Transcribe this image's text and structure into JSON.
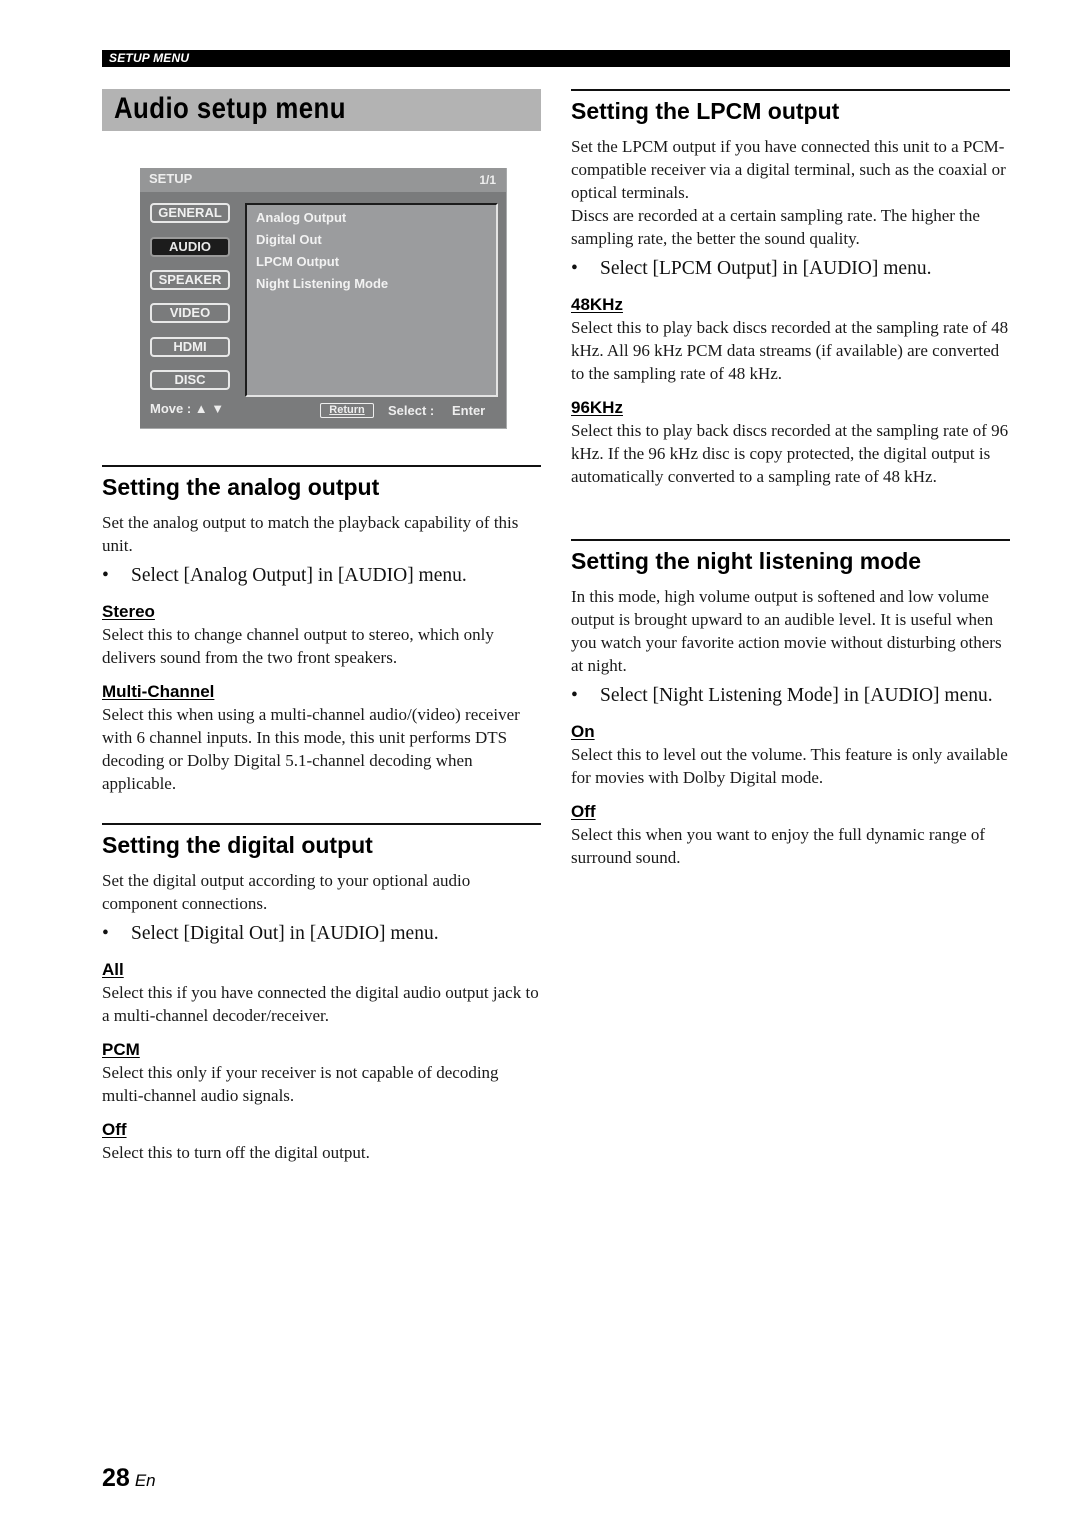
{
  "header": {
    "section_label": "SETUP MENU"
  },
  "page_title": "Audio setup menu",
  "osd_menu": {
    "title": "SETUP",
    "page_indicator": "1/1",
    "categories": [
      {
        "label": "GENERAL",
        "active": false
      },
      {
        "label": "AUDIO",
        "active": true
      },
      {
        "label": "SPEAKER",
        "active": false
      },
      {
        "label": "VIDEO",
        "active": false
      },
      {
        "label": "HDMI",
        "active": false
      },
      {
        "label": "DISC",
        "active": false
      }
    ],
    "items": [
      "Analog Output",
      "Digital Out",
      "LPCM Output",
      "Night Listening Mode"
    ],
    "footer": {
      "move_label": "Move : ▲ ▼",
      "return_label": "Return",
      "select_label": "Select :",
      "enter_label": "Enter"
    }
  },
  "sections": {
    "analog": {
      "heading": "Setting the analog output",
      "intro": "Set the analog output to match the playback capability of this unit.",
      "bullet": "Select [Analog Output] in [AUDIO] menu.",
      "options": [
        {
          "name": "Stereo",
          "desc": "Select this to change channel output to stereo, which only delivers sound from the two front speakers."
        },
        {
          "name": "Multi-Channel",
          "desc": "Select this when using a multi-channel audio/(video) receiver with 6 channel inputs. In this mode, this unit performs DTS decoding or Dolby Digital 5.1-channel decoding when applicable."
        }
      ]
    },
    "digital": {
      "heading": "Setting the digital output",
      "intro": "Set the digital output according to your optional audio component connections.",
      "bullet": "Select [Digital Out] in [AUDIO] menu.",
      "options": [
        {
          "name": "All",
          "desc": "Select this if you have connected the digital audio output jack to a multi-channel decoder/receiver."
        },
        {
          "name": "PCM",
          "desc": "Select this only if your receiver is not capable of decoding multi-channel audio signals."
        },
        {
          "name": "Off",
          "desc": "Select this to turn off the digital output."
        }
      ]
    },
    "lpcm": {
      "heading": "Setting the LPCM output",
      "intro": "Set the LPCM output if you have connected this unit to a PCM-compatible receiver via a digital terminal, such as the coaxial or optical terminals.",
      "intro2": "Discs are recorded at a certain sampling rate. The higher the sampling rate, the better the sound quality.",
      "bullet": "Select [LPCM Output] in [AUDIO] menu.",
      "options": [
        {
          "name": "48KHz",
          "desc": "Select this to play back discs recorded at the sampling rate of 48 kHz. All 96 kHz PCM data streams (if available) are converted to the sampling rate of 48 kHz."
        },
        {
          "name": "96KHz",
          "desc": "Select this to play back discs recorded at the sampling rate of 96 kHz. If the 96 kHz disc is copy protected, the digital output is automatically converted to a sampling rate of 48 kHz."
        }
      ]
    },
    "night": {
      "heading": "Setting the night listening mode",
      "intro": "In this mode, high volume output is softened and low volume output is brought upward to an audible level. It is useful when you watch your favorite action movie without disturbing others at night.",
      "bullet": "Select [Night Listening Mode] in [AUDIO] menu.",
      "options": [
        {
          "name": "On",
          "desc": "Select this to level out the volume. This feature is only available for movies with Dolby Digital mode."
        },
        {
          "name": "Off",
          "desc": "Select this when you want to enjoy the full dynamic range of surround sound."
        }
      ]
    }
  },
  "footer": {
    "page_number": "28",
    "language": "En"
  }
}
